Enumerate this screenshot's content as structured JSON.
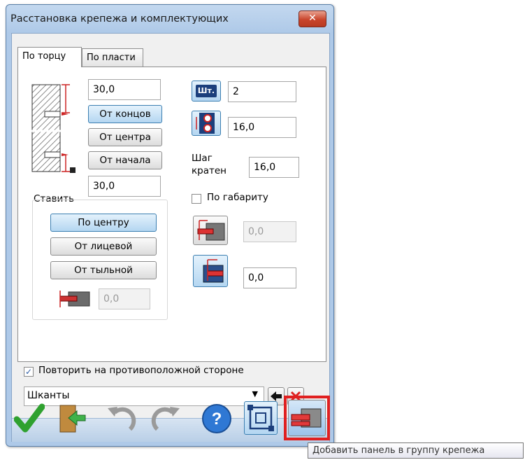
{
  "dialog": {
    "title": "Расстановка крепежа и комплектующих",
    "close_symbol": "✕"
  },
  "tabs": [
    {
      "label": "По торцу",
      "active": true
    },
    {
      "label": "По пласти",
      "active": false
    }
  ],
  "torets": {
    "offset_top": "30,0",
    "offset_bottom": "30,0",
    "from_ends_label": "От концов",
    "from_center_label": "От центра",
    "from_start_label": "От начала"
  },
  "place": {
    "group_label": "Ставить",
    "center_label": "По центру",
    "face_label": "От лицевой",
    "back_label": "От тыльной",
    "offset_value": "0,0"
  },
  "count": {
    "pcs_label": "Шт.",
    "pcs_value": "2",
    "distance_value": "16,0",
    "step_label_line1": "Шаг",
    "step_label_line2": "кратен",
    "step_value": "16,0"
  },
  "gabarit": {
    "label": "По габариту",
    "checked": false
  },
  "depth": {
    "value_disabled": "0,0",
    "value": "0,0"
  },
  "repeat": {
    "label": "Повторить на противоположной стороне",
    "checked": true
  },
  "fastener": {
    "selected": "Шканты"
  },
  "toolbar": {
    "highlight_color": "#e02020"
  },
  "tooltip": {
    "text": "Добавить панель в группу крепежа"
  }
}
